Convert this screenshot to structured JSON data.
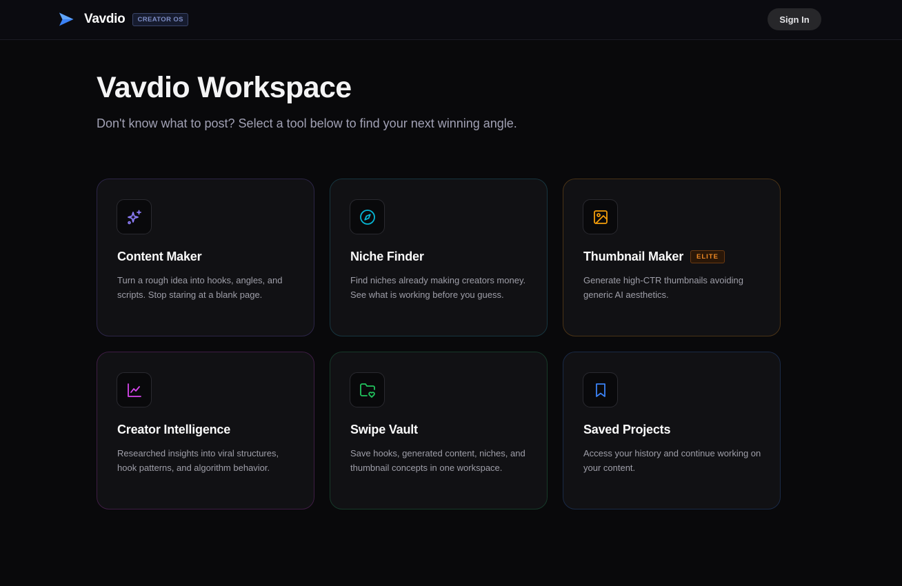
{
  "header": {
    "brand_name": "Vavdio",
    "brand_badge": "CREATOR OS",
    "signin_label": "Sign In",
    "logo_icon": "chevron-right-logo-icon",
    "accent_color": "#3b82f6"
  },
  "main": {
    "title": "Vavdio Workspace",
    "subtitle": "Don't know what to post? Select a tool below to find your next winning angle."
  },
  "tools": [
    {
      "title": "Content Maker",
      "description": "Turn a rough idea into hooks, angles, and scripts. Stop staring at a blank page.",
      "icon": "sparkles-icon",
      "accent": "#8b7cf6"
    },
    {
      "title": "Niche Finder",
      "description": "Find niches already making creators money. See what is working before you guess.",
      "icon": "compass-icon",
      "accent": "#06b6d4"
    },
    {
      "title": "Thumbnail Maker",
      "badge": "ELITE",
      "description": "Generate high-CTR thumbnails avoiding generic AI aesthetics.",
      "icon": "image-icon",
      "accent": "#f59e0b"
    },
    {
      "title": "Creator Intelligence",
      "description": "Researched insights into viral structures, hook patterns, and algorithm behavior.",
      "icon": "line-chart-icon",
      "accent": "#d946ef"
    },
    {
      "title": "Swipe Vault",
      "description": "Save hooks, generated content, niches, and thumbnail concepts in one workspace.",
      "icon": "folder-heart-icon",
      "accent": "#22c55e"
    },
    {
      "title": "Saved Projects",
      "description": "Access your history and continue working on your content.",
      "icon": "bookmark-icon",
      "accent": "#3b82f6"
    }
  ]
}
